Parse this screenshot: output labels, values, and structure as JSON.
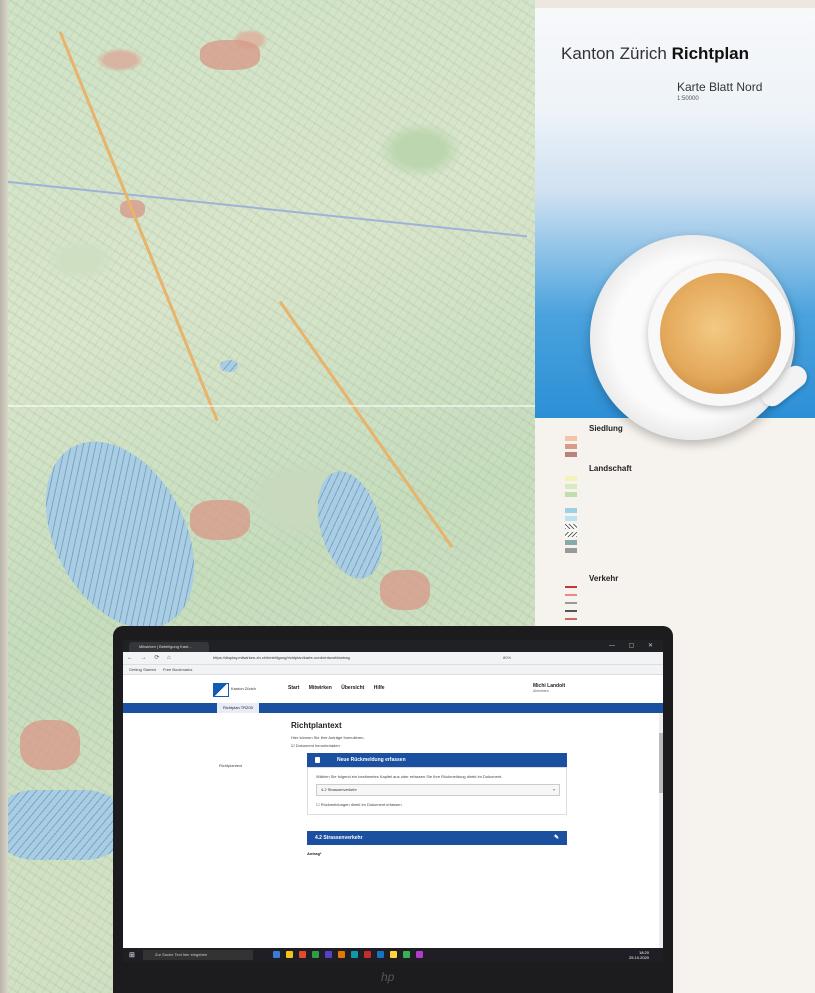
{
  "sheet": {
    "title_light": "Kanton Zürich",
    "title_bold": "Richtplan",
    "subtitle": "Karte Blatt Nord",
    "scale": "1:50000"
  },
  "legend": {
    "siedlung": "Siedlung",
    "landschaft": "Landschaft",
    "verkehr": "Verkehr"
  },
  "browser": {
    "tab_title": "Mitwirken | Beteiligung Kant...",
    "url": "https://display.mitwirken-zh.ch/beteiligung/richtplan/karte-nord/entwurf#antrag",
    "zoom": "80%",
    "bookmarks": [
      "Getting Started",
      "Free Bookmarks"
    ]
  },
  "app": {
    "logo_text": "Kanton Zürich",
    "nav": [
      "Start",
      "Mitwirken",
      "Übersicht",
      "Hilfe"
    ],
    "user_name": "Michi Landolt",
    "user_sub": "Abmelden",
    "tab_label": "Richtplan TRZ00",
    "left_label": "Richtplantext",
    "heading": "Richtplantext",
    "intro": "Hier können Sie Ihre Anträge formulieren.",
    "checkbox1": "Dokument herunterladen",
    "panel1_title": "Neue Rückmeldung erfassen",
    "panel1_text": "Wählen Sie folgend ein bestimmtes Kapitel aus oder erfassen Sie Ihre Rückmeldung direkt im Dokument.",
    "select_value": "4.2 Strassenverkehr",
    "checkbox2": "Rückmeldungen direkt im Dokument erfassen",
    "panel2_title": "4.2 Strassenverkehr",
    "antrag": "Antrag*"
  },
  "taskbar": {
    "search_placeholder": "Zur Suche Text hier eingeben",
    "time": "18:20",
    "date": "25.10.2020"
  },
  "colors": {
    "brand_blue": "#1b4fa0",
    "sheet_blue": "#2c8fd6",
    "coffee": "#e3a85a"
  }
}
